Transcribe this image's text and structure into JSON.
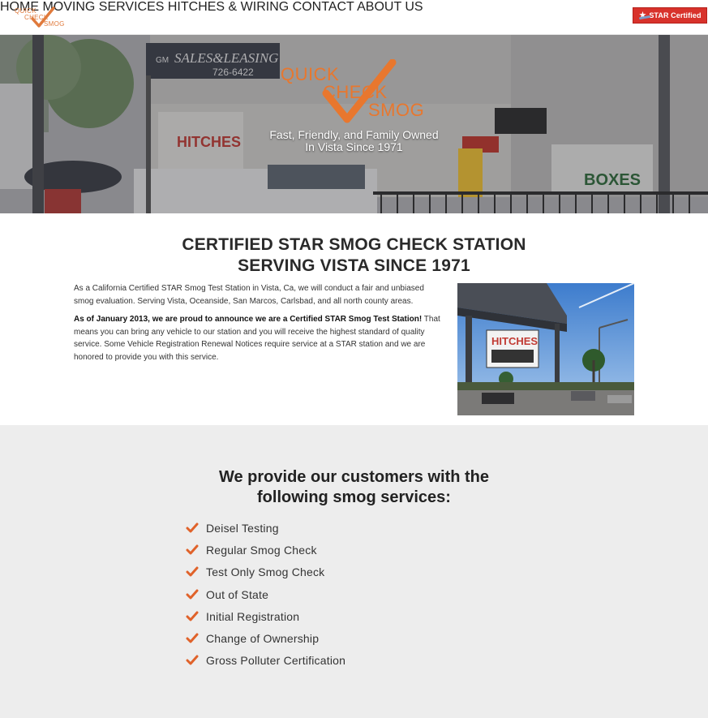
{
  "header": {
    "logo": {
      "line1": "QUICK",
      "line2": "CHECK",
      "line3": "SMOG"
    },
    "nav": [
      {
        "label": "HOME"
      },
      {
        "label": "MOVING SERVICES"
      },
      {
        "label": "HITCHES & WIRING"
      },
      {
        "label": "CONTACT"
      },
      {
        "label": "ABOUT US"
      }
    ],
    "badge": {
      "label": "STAR Certified",
      "icon": "star-icon",
      "color": "#d8322b"
    }
  },
  "hero": {
    "logo": {
      "line1": "QUICK",
      "line2": "CHECK",
      "line3": "SMOG"
    },
    "tagline_line1": "Fast, Friendly, and Family Owned",
    "tagline_line2": "In Vista Since 1971",
    "signs": {
      "sales": "SALES&LEASING",
      "gm": "GM",
      "phone": "726-6422",
      "hitches": "HITCHES",
      "boxes": "BOXES",
      "hitches2": "HITCHES"
    }
  },
  "intro": {
    "title_line1": "CERTIFIED STAR SMOG CHECK STATION",
    "title_line2": "SERVING VISTA SINCE 1971",
    "p1": "As a California Certified STAR Smog Test Station in Vista, Ca, we will conduct a fair and unbiased smog evaluation. Serving Vista, Oceanside, San Marcos, Carlsbad, and all north county areas.",
    "p2_bold": "As of January 2013, we are proud to announce we are a Certified STAR Smog Test Station!",
    "p2_rest": " That means you can bring any vehicle to our station and you will receive the highest standard of quality service. Some Vehicle Registration Renewal Notices require service at a STAR station and we are honored to provide you with this service.",
    "photo_sign": "HITCHES"
  },
  "services": {
    "title_line1": "We provide our customers with the",
    "title_line2": "following smog services:",
    "check_color": "#e0622a",
    "items": [
      {
        "label": "Deisel Testing"
      },
      {
        "label": "Regular Smog Check"
      },
      {
        "label": "Test Only Smog Check"
      },
      {
        "label": "Out of State"
      },
      {
        "label": "Initial Registration"
      },
      {
        "label": "Change of Ownership"
      },
      {
        "label": "Gross Polluter Certification"
      }
    ]
  }
}
